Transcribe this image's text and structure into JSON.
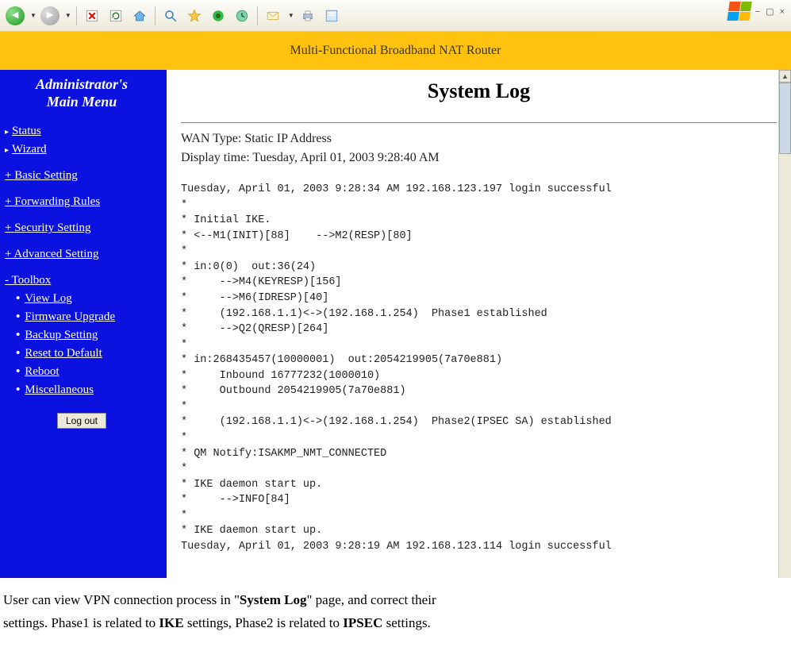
{
  "window": {
    "controls": "− ▢ ×"
  },
  "banner": {
    "title": "Multi-Functional Broadband NAT Router"
  },
  "sidebar": {
    "heading_line1": "Administrator's",
    "heading_line2": "Main Menu",
    "top": [
      {
        "label": "Status"
      },
      {
        "label": "Wizard"
      }
    ],
    "sections": [
      {
        "label": "+ Basic Setting"
      },
      {
        "label": "+ Forwarding Rules"
      },
      {
        "label": "+ Security Setting"
      },
      {
        "label": "+ Advanced Setting"
      }
    ],
    "toolbox_label": "- Toolbox",
    "toolbox": [
      {
        "label": "View Log"
      },
      {
        "label": "Firmware Upgrade"
      },
      {
        "label": "Backup Setting"
      },
      {
        "label": "Reset to Default"
      },
      {
        "label": "Reboot"
      },
      {
        "label": "Miscellaneous"
      }
    ],
    "logout": "Log out"
  },
  "content": {
    "title": "System Log",
    "wan_line": "WAN Type: Static IP Address",
    "display_line": "Display time: Tuesday, April 01, 2003 9:28:40 AM",
    "log_text": "Tuesday, April 01, 2003 9:28:34 AM 192.168.123.197 login successful\n*\n* Initial IKE.\n* <--M1(INIT)[88]    -->M2(RESP)[80]\n*\n* in:0(0)  out:36(24)\n*     -->M4(KEYRESP)[156]\n*     -->M6(IDRESP)[40]\n*     (192.168.1.1)<->(192.168.1.254)  Phase1 established\n*     -->Q2(QRESP)[264]\n*\n* in:268435457(10000001)  out:2054219905(7a70e881)\n*     Inbound 16777232(1000010)\n*     Outbound 2054219905(7a70e881)\n*\n*     (192.168.1.1)<->(192.168.1.254)  Phase2(IPSEC SA) established\n*\n* QM Notify:ISAKMP_NMT_CONNECTED\n*\n* IKE daemon start up.\n*     -->INFO[84]\n*\n* IKE daemon start up.\nTuesday, April 01, 2003 9:28:19 AM 192.168.123.114 login successful"
  },
  "caption": {
    "t1": "User can view VPN connection process in \"",
    "t2": "System Log",
    "t3": "\" page, and correct their",
    "t4": "settings. Phase1 is related to ",
    "t5": "IKE",
    "t6": " settings, Phase2 is related to ",
    "t7": "IPSEC",
    "t8": " settings."
  }
}
